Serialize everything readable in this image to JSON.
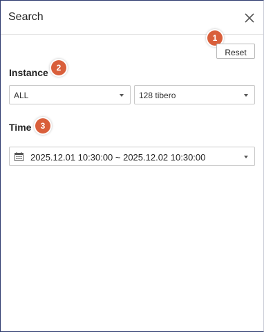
{
  "header": {
    "title": "Search",
    "close_icon": "close-icon"
  },
  "actions": {
    "reset_label": "Reset"
  },
  "badges": [
    "1",
    "2",
    "3"
  ],
  "instance": {
    "label": "Instance",
    "primary_value": "ALL",
    "secondary_value": "128 tibero"
  },
  "time": {
    "label": "Time",
    "range_value": "2025.12.01 10:30:00 ~ 2025.12.02 10:30:00",
    "calendar_icon": "calendar-icon"
  },
  "colors": {
    "badge": "#d95f3b",
    "border_accent": "#2d3a6e"
  }
}
